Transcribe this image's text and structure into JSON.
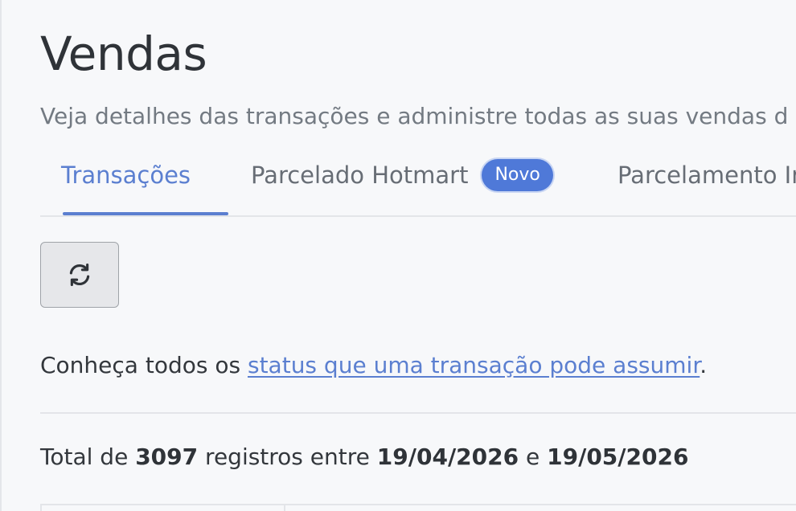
{
  "page": {
    "title": "Vendas",
    "subtitle": "Veja detalhes das transações e administre todas as suas vendas d"
  },
  "tabs": [
    {
      "label": "Transações",
      "active": true
    },
    {
      "label": "Parcelado Hotmart",
      "badge": "Novo",
      "active": false
    },
    {
      "label": "Parcelamento In",
      "active": false
    }
  ],
  "toolbar": {
    "refresh_icon": "refresh-icon"
  },
  "status_info": {
    "prefix": "Conheça todos os ",
    "link_text": "status que uma transação pode assumir",
    "suffix": "."
  },
  "summary": {
    "prefix": "Total de ",
    "count": "3097",
    "middle": " registros entre ",
    "start_date": "19/04/2026",
    "conjunction": " e ",
    "end_date": "19/05/2026"
  },
  "colors": {
    "accent": "#5b7fd0",
    "badge": "#4f79d8",
    "background": "#f7f8fa"
  }
}
